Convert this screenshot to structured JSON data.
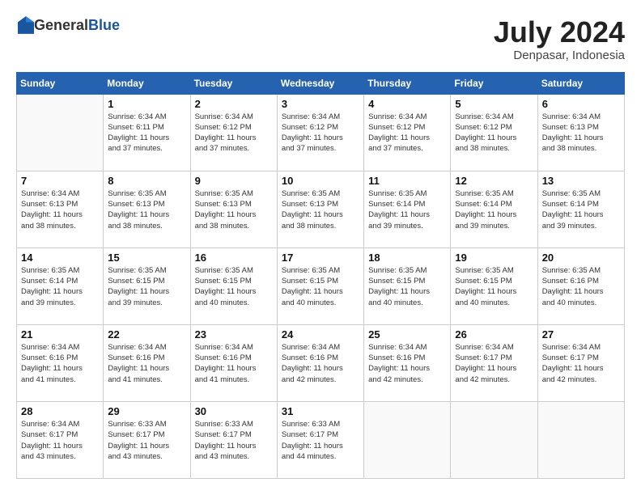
{
  "header": {
    "logo_general": "General",
    "logo_blue": "Blue",
    "month_year": "July 2024",
    "location": "Denpasar, Indonesia"
  },
  "columns": [
    "Sunday",
    "Monday",
    "Tuesday",
    "Wednesday",
    "Thursday",
    "Friday",
    "Saturday"
  ],
  "weeks": [
    [
      {
        "day": "",
        "info": ""
      },
      {
        "day": "1",
        "info": "Sunrise: 6:34 AM\nSunset: 6:11 PM\nDaylight: 11 hours\nand 37 minutes."
      },
      {
        "day": "2",
        "info": "Sunrise: 6:34 AM\nSunset: 6:12 PM\nDaylight: 11 hours\nand 37 minutes."
      },
      {
        "day": "3",
        "info": "Sunrise: 6:34 AM\nSunset: 6:12 PM\nDaylight: 11 hours\nand 37 minutes."
      },
      {
        "day": "4",
        "info": "Sunrise: 6:34 AM\nSunset: 6:12 PM\nDaylight: 11 hours\nand 37 minutes."
      },
      {
        "day": "5",
        "info": "Sunrise: 6:34 AM\nSunset: 6:12 PM\nDaylight: 11 hours\nand 38 minutes."
      },
      {
        "day": "6",
        "info": "Sunrise: 6:34 AM\nSunset: 6:13 PM\nDaylight: 11 hours\nand 38 minutes."
      }
    ],
    [
      {
        "day": "7",
        "info": "Sunrise: 6:34 AM\nSunset: 6:13 PM\nDaylight: 11 hours\nand 38 minutes."
      },
      {
        "day": "8",
        "info": "Sunrise: 6:35 AM\nSunset: 6:13 PM\nDaylight: 11 hours\nand 38 minutes."
      },
      {
        "day": "9",
        "info": "Sunrise: 6:35 AM\nSunset: 6:13 PM\nDaylight: 11 hours\nand 38 minutes."
      },
      {
        "day": "10",
        "info": "Sunrise: 6:35 AM\nSunset: 6:13 PM\nDaylight: 11 hours\nand 38 minutes."
      },
      {
        "day": "11",
        "info": "Sunrise: 6:35 AM\nSunset: 6:14 PM\nDaylight: 11 hours\nand 39 minutes."
      },
      {
        "day": "12",
        "info": "Sunrise: 6:35 AM\nSunset: 6:14 PM\nDaylight: 11 hours\nand 39 minutes."
      },
      {
        "day": "13",
        "info": "Sunrise: 6:35 AM\nSunset: 6:14 PM\nDaylight: 11 hours\nand 39 minutes."
      }
    ],
    [
      {
        "day": "14",
        "info": "Sunrise: 6:35 AM\nSunset: 6:14 PM\nDaylight: 11 hours\nand 39 minutes."
      },
      {
        "day": "15",
        "info": "Sunrise: 6:35 AM\nSunset: 6:15 PM\nDaylight: 11 hours\nand 39 minutes."
      },
      {
        "day": "16",
        "info": "Sunrise: 6:35 AM\nSunset: 6:15 PM\nDaylight: 11 hours\nand 40 minutes."
      },
      {
        "day": "17",
        "info": "Sunrise: 6:35 AM\nSunset: 6:15 PM\nDaylight: 11 hours\nand 40 minutes."
      },
      {
        "day": "18",
        "info": "Sunrise: 6:35 AM\nSunset: 6:15 PM\nDaylight: 11 hours\nand 40 minutes."
      },
      {
        "day": "19",
        "info": "Sunrise: 6:35 AM\nSunset: 6:15 PM\nDaylight: 11 hours\nand 40 minutes."
      },
      {
        "day": "20",
        "info": "Sunrise: 6:35 AM\nSunset: 6:16 PM\nDaylight: 11 hours\nand 40 minutes."
      }
    ],
    [
      {
        "day": "21",
        "info": "Sunrise: 6:34 AM\nSunset: 6:16 PM\nDaylight: 11 hours\nand 41 minutes."
      },
      {
        "day": "22",
        "info": "Sunrise: 6:34 AM\nSunset: 6:16 PM\nDaylight: 11 hours\nand 41 minutes."
      },
      {
        "day": "23",
        "info": "Sunrise: 6:34 AM\nSunset: 6:16 PM\nDaylight: 11 hours\nand 41 minutes."
      },
      {
        "day": "24",
        "info": "Sunrise: 6:34 AM\nSunset: 6:16 PM\nDaylight: 11 hours\nand 42 minutes."
      },
      {
        "day": "25",
        "info": "Sunrise: 6:34 AM\nSunset: 6:16 PM\nDaylight: 11 hours\nand 42 minutes."
      },
      {
        "day": "26",
        "info": "Sunrise: 6:34 AM\nSunset: 6:17 PM\nDaylight: 11 hours\nand 42 minutes."
      },
      {
        "day": "27",
        "info": "Sunrise: 6:34 AM\nSunset: 6:17 PM\nDaylight: 11 hours\nand 42 minutes."
      }
    ],
    [
      {
        "day": "28",
        "info": "Sunrise: 6:34 AM\nSunset: 6:17 PM\nDaylight: 11 hours\nand 43 minutes."
      },
      {
        "day": "29",
        "info": "Sunrise: 6:33 AM\nSunset: 6:17 PM\nDaylight: 11 hours\nand 43 minutes."
      },
      {
        "day": "30",
        "info": "Sunrise: 6:33 AM\nSunset: 6:17 PM\nDaylight: 11 hours\nand 43 minutes."
      },
      {
        "day": "31",
        "info": "Sunrise: 6:33 AM\nSunset: 6:17 PM\nDaylight: 11 hours\nand 44 minutes."
      },
      {
        "day": "",
        "info": ""
      },
      {
        "day": "",
        "info": ""
      },
      {
        "day": "",
        "info": ""
      }
    ]
  ]
}
